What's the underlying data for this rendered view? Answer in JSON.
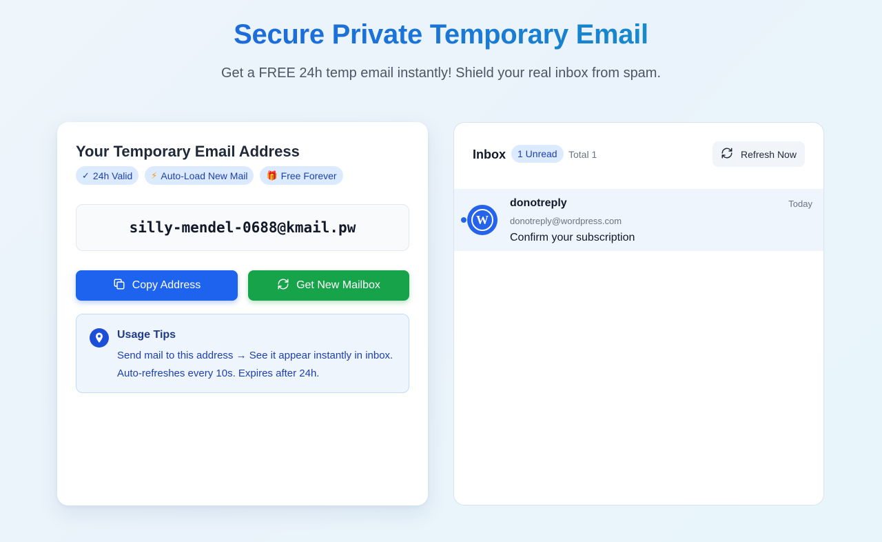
{
  "hero": {
    "title": "Secure Private Temporary Email",
    "subtitle": "Get a FREE 24h temp email instantly! Shield your real inbox from spam."
  },
  "address_card": {
    "title": "Your Temporary Email Address",
    "badges": [
      {
        "icon": "check-icon",
        "glyph": "✓",
        "label": "24h Valid"
      },
      {
        "icon": "lightning-icon",
        "glyph": "⚡",
        "label": "Auto-Load New Mail"
      },
      {
        "icon": "gift-icon",
        "glyph": "🎁",
        "label": "Free Forever"
      }
    ],
    "email": "silly-mendel-0688@kmail.pw",
    "copy_label": "Copy Address",
    "new_label": "Get New Mailbox",
    "tips": {
      "title": "Usage Tips",
      "text": "Send mail to this address → See it appear instantly in inbox. Auto-refreshes every 10s. Expires after 24h."
    }
  },
  "inbox": {
    "title": "Inbox",
    "unread": "1 Unread",
    "total": "Total 1",
    "refresh_label": "Refresh Now",
    "messages": [
      {
        "sender": "donotreply",
        "sender_email": "donotreply@wordpress.com",
        "subject": "Confirm your subscription",
        "date": "Today",
        "unread": true,
        "avatar": "wordpress-logo-icon"
      }
    ]
  },
  "colors": {
    "primary": "#1d63ed",
    "success": "#16a34a",
    "badge_bg": "#dbeafe",
    "badge_text": "#1e40af",
    "title_gradient": [
      "#1e5fe0",
      "#13a0c0"
    ]
  }
}
